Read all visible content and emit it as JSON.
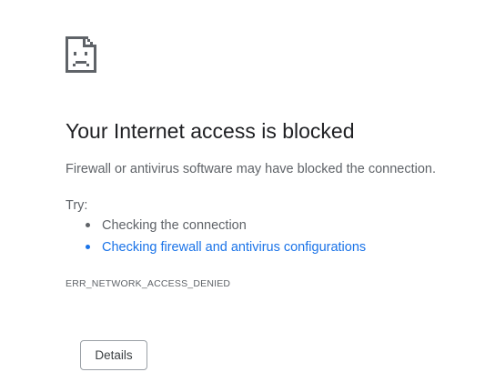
{
  "error_page": {
    "icon": "sad-document-icon",
    "title": "Your Internet access is blocked",
    "summary": "Firewall or antivirus software may have blocked the connection.",
    "try_label": "Try:",
    "suggestions": [
      {
        "text": "Checking the connection",
        "is_link": false
      },
      {
        "text": "Checking firewall and antivirus configurations",
        "is_link": true
      }
    ],
    "error_code": "ERR_NETWORK_ACCESS_DENIED",
    "details_button_label": "Details"
  },
  "colors": {
    "title": "#202124",
    "body_text": "#5f6368",
    "link": "#1a73e8",
    "button_border": "#9aa0a6",
    "background": "#ffffff"
  }
}
